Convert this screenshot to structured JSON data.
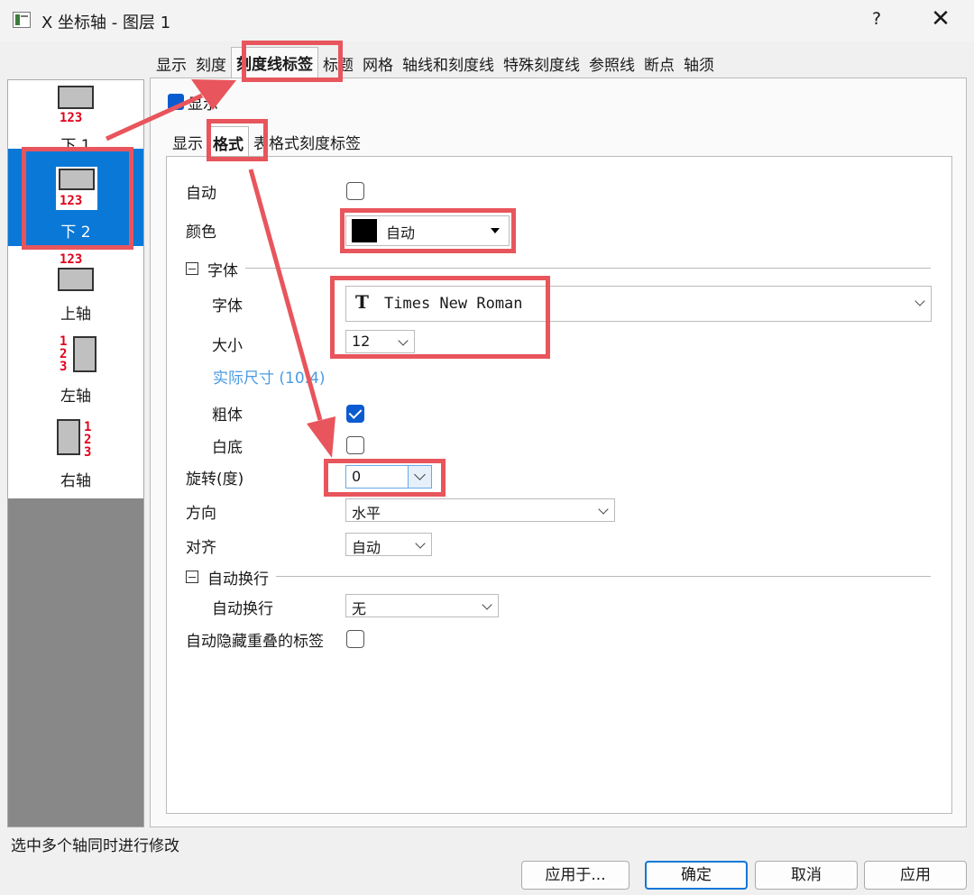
{
  "window": {
    "title": "X 坐标轴 - 图层 1",
    "help": "?",
    "close": "✕"
  },
  "top_tabs": [
    "显示",
    "刻度",
    "刻度线标签",
    "标题",
    "网格",
    "轴线和刻度线",
    "特殊刻度线",
    "参照线",
    "断点",
    "轴须"
  ],
  "axis_list": {
    "items": [
      {
        "label": "下 1",
        "nums": "123"
      },
      {
        "label": "下 2",
        "nums": "123"
      },
      {
        "label": "上轴",
        "nums": "123"
      },
      {
        "label": "左轴",
        "nums": "1\n2\n3"
      },
      {
        "label": "右轴",
        "nums": "1\n2\n3"
      }
    ]
  },
  "show_checkbox": {
    "label": "显示",
    "checked": true
  },
  "sub_tabs": [
    "显示",
    "格式",
    "表格式刻度标签"
  ],
  "format": {
    "auto_label": "自动",
    "color_label": "颜色",
    "color_value": "自动",
    "font_section": "字体",
    "font_label": "字体",
    "font_icon": "T",
    "font_value": "Times New Roman",
    "size_label": "大小",
    "size_value": "12",
    "actual_size": "实际尺寸 (10.4)",
    "bold_label": "粗体",
    "white_bg_label": "白底",
    "rotation_label": "旋转(度)",
    "rotation_value": "0",
    "direction_label": "方向",
    "direction_value": "水平",
    "align_label": "对齐",
    "align_value": "自动",
    "wrap_section": "自动换行",
    "wrap_label": "自动换行",
    "wrap_value": "无",
    "hide_overlap_label": "自动隐藏重叠的标签"
  },
  "status": "选中多个轴同时进行修改",
  "buttons": {
    "apply_to": "应用于...",
    "ok": "确定",
    "cancel": "取消",
    "apply": "应用"
  },
  "colors": {
    "accent": "#0a78d7",
    "highlight": "#e8555c",
    "axis_numbers": "#e0001b"
  }
}
